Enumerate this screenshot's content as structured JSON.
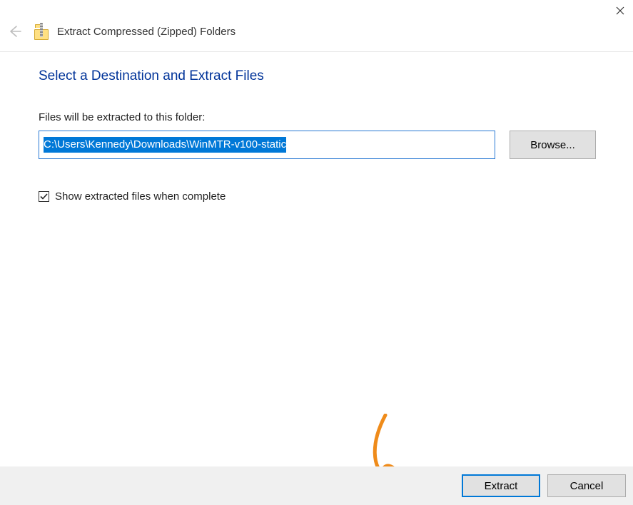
{
  "header": {
    "title": "Extract Compressed (Zipped) Folders"
  },
  "main": {
    "heading": "Select a Destination and Extract Files",
    "path_label": "Files will be extracted to this folder:",
    "path_value": "C:\\Users\\Kennedy\\Downloads\\WinMTR-v100-static",
    "browse_label": "Browse...",
    "checkbox_label": "Show extracted files when complete",
    "checkbox_checked": true
  },
  "footer": {
    "extract_label": "Extract",
    "cancel_label": "Cancel"
  }
}
